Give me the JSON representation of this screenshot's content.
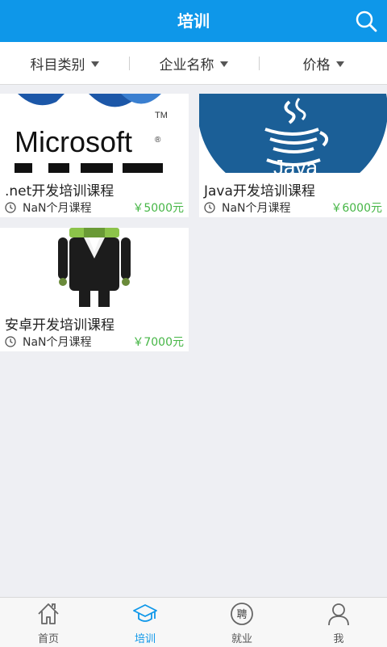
{
  "header": {
    "title": "培训",
    "search_icon": "search-icon"
  },
  "filters": [
    {
      "label": "科目类别"
    },
    {
      "label": "企业名称"
    },
    {
      "label": "价格"
    }
  ],
  "courses": [
    {
      "title": ".net开发培训课程",
      "duration": "NaN个月课程",
      "price": "￥5000元",
      "image_text": "Microsoft"
    },
    {
      "title": "Java开发培训课程",
      "duration": "NaN个月课程",
      "price": "￥6000元",
      "image_text": "Java"
    },
    {
      "title": "安卓开发培训课程",
      "duration": "NaN个月课程",
      "price": "￥7000元"
    }
  ],
  "tabs": [
    {
      "label": "首页",
      "icon": "home-icon"
    },
    {
      "label": "培训",
      "icon": "graduation-cap-icon",
      "active": true
    },
    {
      "label": "就业",
      "icon": "job-icon",
      "glyph": "聘"
    },
    {
      "label": "我",
      "icon": "user-icon"
    }
  ],
  "colors": {
    "accent": "#0e97e9",
    "price": "#46b646",
    "background": "#eeeff3"
  }
}
